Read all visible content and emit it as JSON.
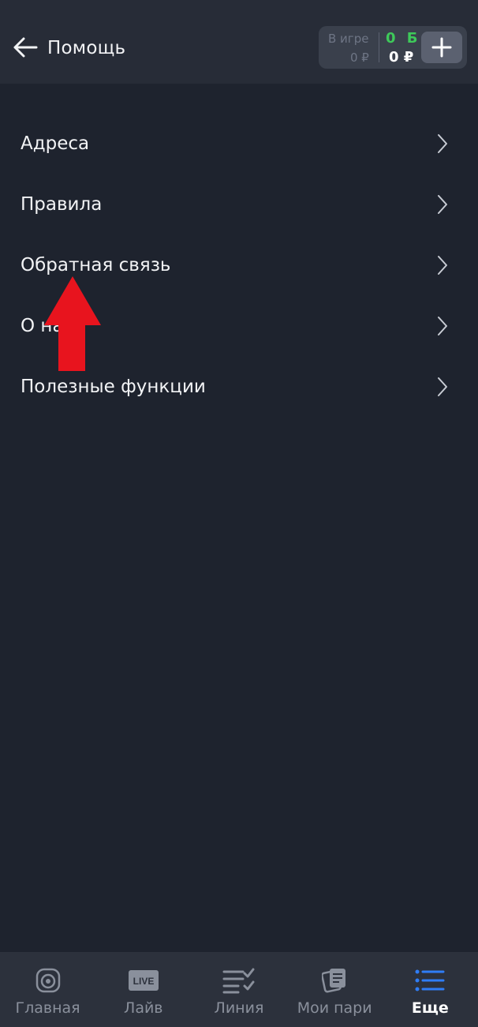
{
  "header": {
    "title": "Помощь",
    "back_icon": "arrow-left-icon",
    "balance": {
      "in_game_label": "В игре",
      "in_game_value": "0 ₽",
      "bonus_value": "0 Б",
      "money_value": "0 ₽",
      "add_icon": "plus-icon"
    }
  },
  "menu": {
    "items": [
      {
        "label": "Адреса"
      },
      {
        "label": "Правила"
      },
      {
        "label": "Обратная связь"
      },
      {
        "label": "О нас"
      },
      {
        "label": "Полезные функции"
      }
    ]
  },
  "bottom_nav": {
    "items": [
      {
        "label": "Главная",
        "icon": "home-ball-icon"
      },
      {
        "label": "Лайв",
        "icon": "live-icon",
        "badge": "LIVE"
      },
      {
        "label": "Линия",
        "icon": "line-list-icon"
      },
      {
        "label": "Мои пари",
        "icon": "bets-icon"
      },
      {
        "label": "Еще",
        "icon": "more-menu-icon",
        "active": true
      }
    ]
  },
  "colors": {
    "background": "#1e232e",
    "topbar": "#272c37",
    "bonus": "#3ec95a",
    "accent": "#2f7df6",
    "annotation_arrow": "#e8141e"
  }
}
